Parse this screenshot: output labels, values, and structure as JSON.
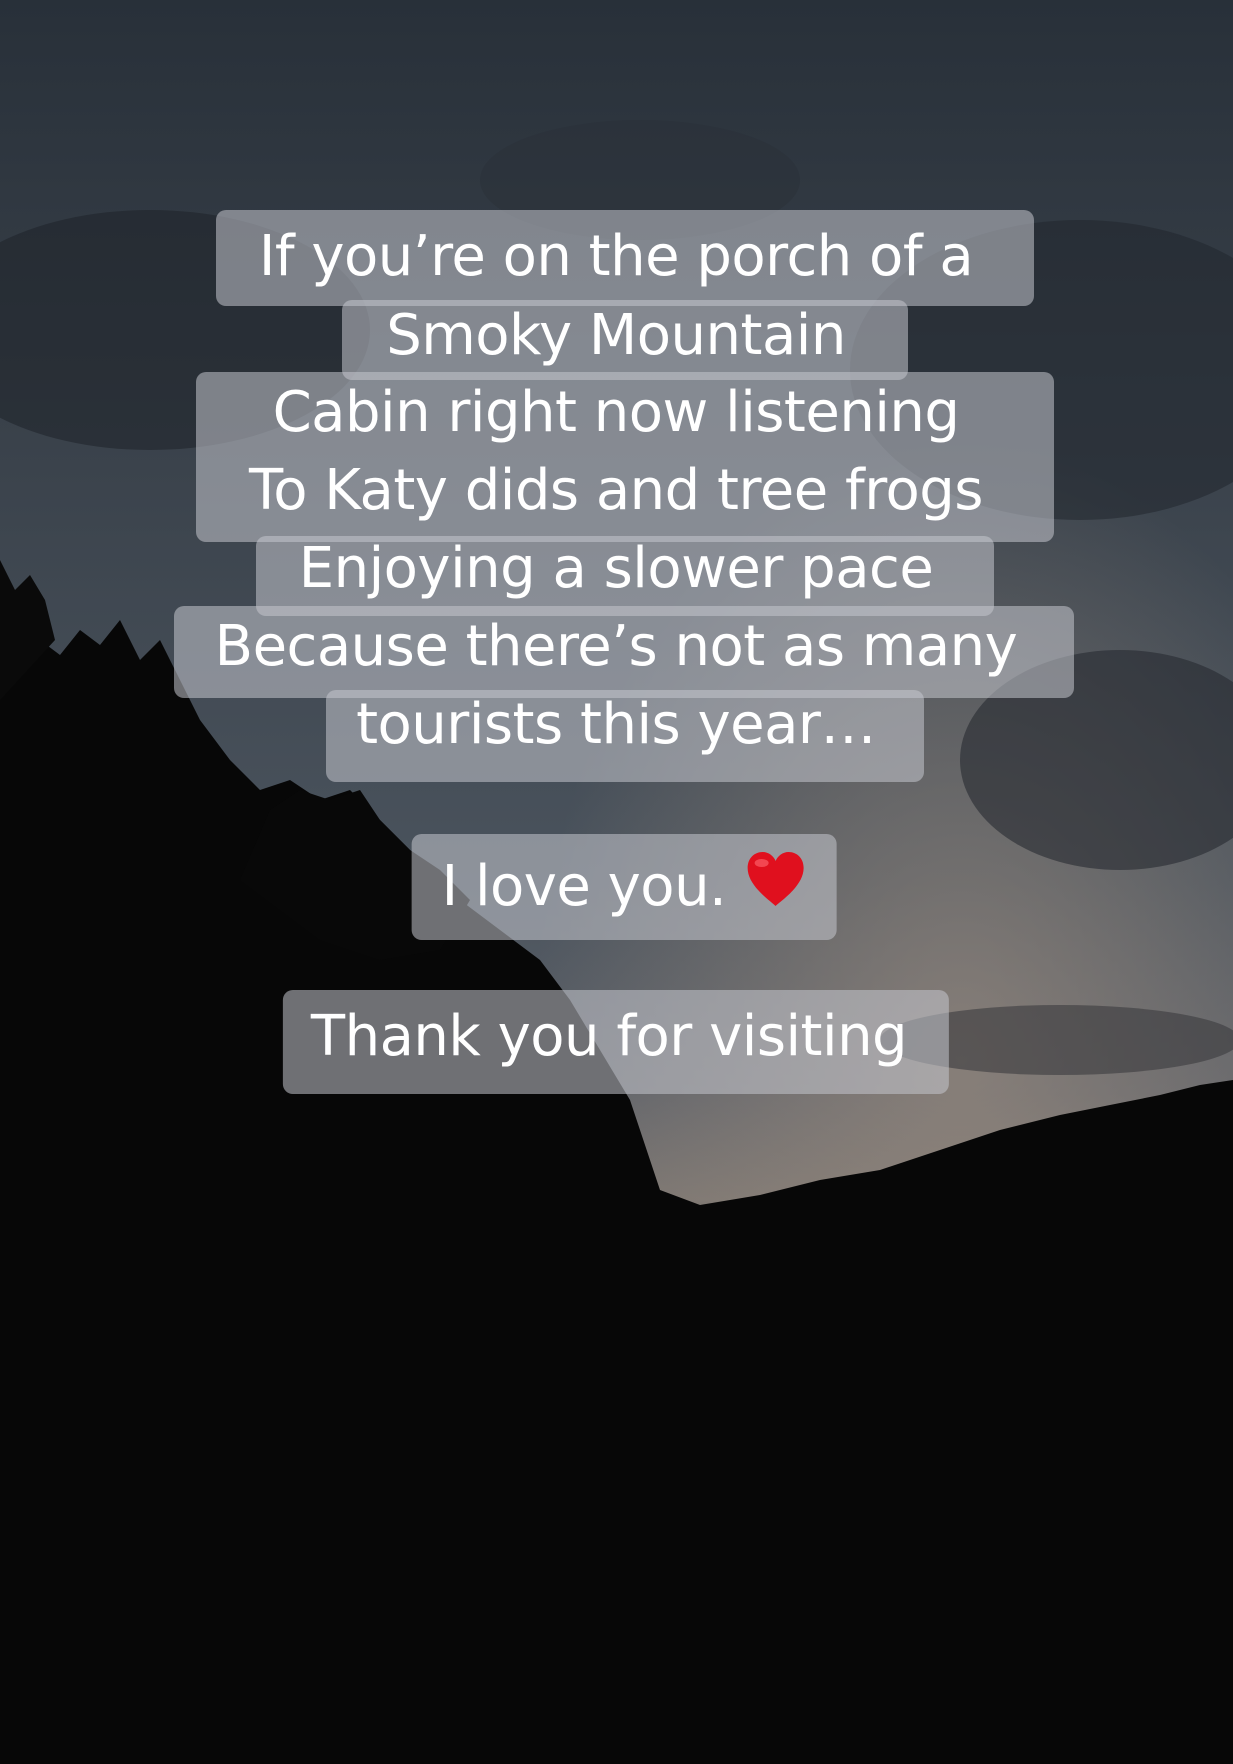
{
  "captions": {
    "lines": [
      "If you’re on the porch of a",
      "Smoky Mountain",
      "Cabin right now listening",
      "To Katy dids and tree frogs",
      "Enjoying a slower pace",
      "Because there’s not as many",
      "tourists this year…"
    ],
    "love": "I love you.",
    "thanks": "Thank you for visiting"
  },
  "icons": {
    "heart": "red-heart-emoji"
  },
  "colors": {
    "caption_bg": "#c4c7cd",
    "caption_text": "#ffffff",
    "heart": "#e0101e"
  }
}
